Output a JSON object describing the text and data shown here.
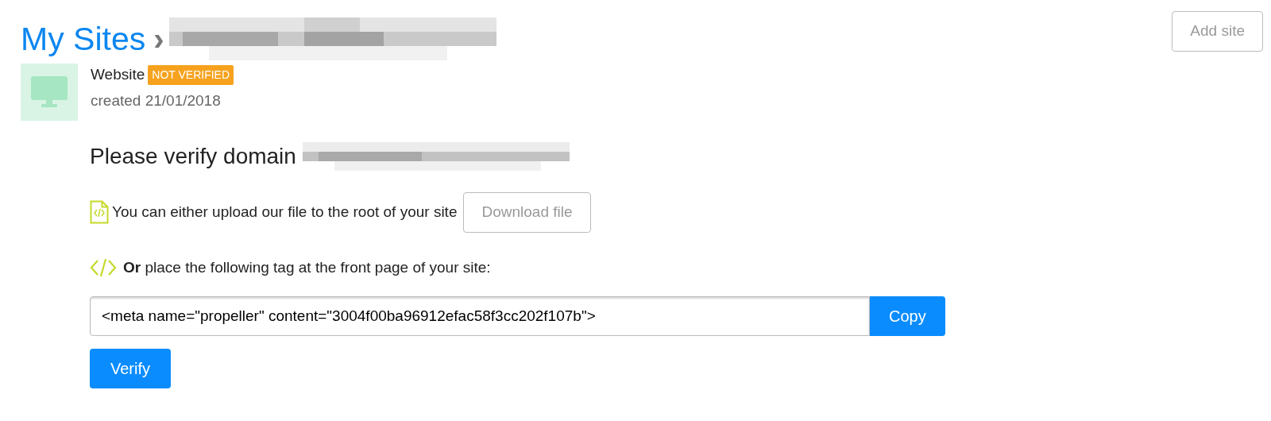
{
  "breadcrumb": {
    "title": "My Sites",
    "separator": "›"
  },
  "add_button": "Add site",
  "site": {
    "type": "Website",
    "status": {
      "label": "NOT VERIFIED",
      "verified": false
    },
    "created": "created 21/01/2018"
  },
  "verify": {
    "heading": "Please verify domain",
    "file_option": {
      "text": "You can either upload our file to the root of your site",
      "button": "Download file"
    },
    "tag_option": {
      "text": "**Or** place the following tag at the front page of your site:"
    },
    "tag_field": {
      "value": "<meta name=\"propeller\" content=\"3004f00ba96912efac58f3cc202f107b\">",
      "button": "Copy"
    },
    "submit": "Verify"
  }
}
